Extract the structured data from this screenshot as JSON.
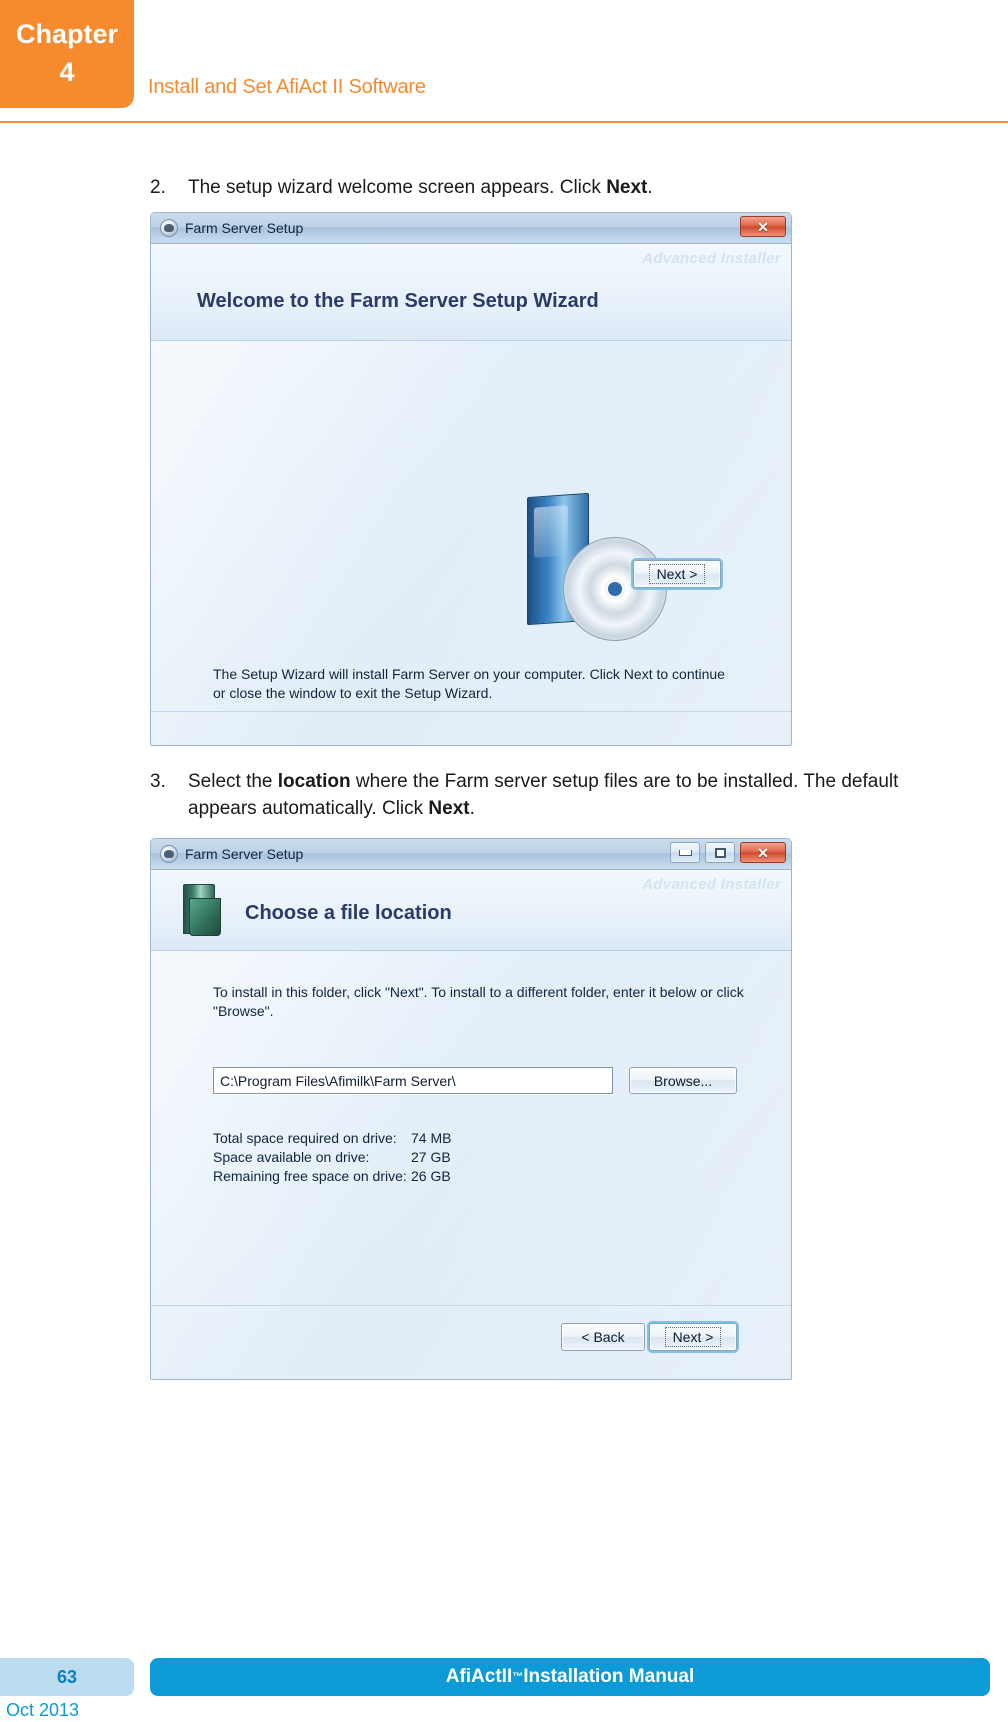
{
  "header": {
    "chapter_word": "Chapter",
    "chapter_number": "4",
    "title": "Install and Set AfiAct II Software",
    "accent_color": "#F58A2E"
  },
  "steps": [
    {
      "number": "2.",
      "text_before": "The setup wizard welcome screen appears. Click ",
      "emphasis": "Next",
      "text_after": "."
    },
    {
      "number": "3.",
      "text_before": "Select the ",
      "emphasis": "location",
      "text_mid": " where the Farm server setup files are to be installed.  The default appears automatically. Click ",
      "emphasis2": "Next",
      "text_after": "."
    }
  ],
  "dialog_welcome": {
    "title": "Farm Server Setup",
    "window_icon": "setup-disc-icon",
    "close_button": "✕",
    "watermark": "Advanced Installer",
    "heading": "Welcome to the Farm Server Setup Wizard",
    "body_text": "The Setup Wizard will install Farm Server on your computer. Click Next to continue or close the window to exit the Setup Wizard.",
    "next_button": "Next >"
  },
  "dialog_location": {
    "title": "Farm Server Setup",
    "window_icon": "setup-disc-icon",
    "minimize_button": "minimize-icon",
    "maximize_button": "maximize-icon",
    "close_button": "✕",
    "watermark": "Advanced Installer",
    "heading": "Choose a file location",
    "folder_icon": "folder-icon",
    "body_text": "To install in this folder, click \"Next\". To install to a different folder, enter it below or click \"Browse\".",
    "path_value": "C:\\Program Files\\Afimilk\\Farm Server\\",
    "browse_button": "Browse...",
    "space_rows": [
      {
        "label": "Total space required on drive:",
        "value": "74 MB"
      },
      {
        "label": "Space available on drive:",
        "value": "27 GB"
      },
      {
        "label": "Remaining free space on drive:",
        "value": "26 GB"
      }
    ],
    "back_button": "< Back",
    "next_button": "Next >"
  },
  "footer": {
    "page_number": "63",
    "manual_title_pre": "AfiAct ",
    "manual_title_roman": "II",
    "manual_title_tm": "™",
    "manual_title_post": " Installation Manual",
    "date": "Oct 2013",
    "bar_color": "#0C9BD6",
    "page_box_color": "#BCDDEF"
  }
}
